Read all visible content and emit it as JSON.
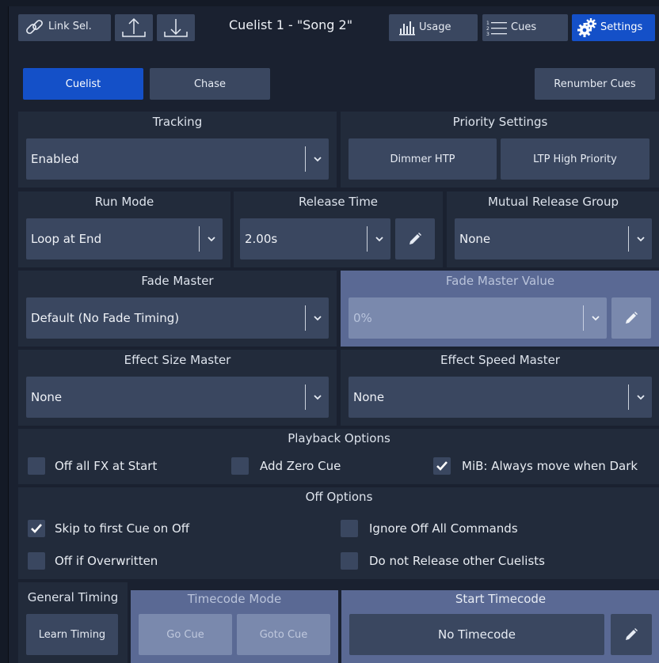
{
  "toolbar": {
    "link_sel": "Link Sel.",
    "title": "Cuelist 1 - \"Song 2\"",
    "usage": "Usage",
    "cues": "Cues",
    "settings": "Settings"
  },
  "mode_tabs": {
    "cuelist": "Cuelist",
    "chase": "Chase",
    "renumber": "Renumber Cues"
  },
  "tracking": {
    "title": "Tracking",
    "value": "Enabled"
  },
  "priority": {
    "title": "Priority Settings",
    "dimmer_htp": "Dimmer HTP",
    "ltp_high": "LTP High Priority"
  },
  "run_mode": {
    "title": "Run Mode",
    "value": "Loop at End"
  },
  "release_time": {
    "title": "Release Time",
    "value": "2.00s"
  },
  "mutual_release": {
    "title": "Mutual Release Group",
    "value": "None"
  },
  "fade_master": {
    "title": "Fade Master",
    "value": "Default (No Fade Timing)"
  },
  "fade_master_value": {
    "title": "Fade Master Value",
    "value": "0%"
  },
  "effect_size": {
    "title": "Effect Size Master",
    "value": "None"
  },
  "effect_speed": {
    "title": "Effect Speed Master",
    "value": "None"
  },
  "playback_options": {
    "title": "Playback Options",
    "items": [
      {
        "label": "Off all FX at Start",
        "checked": false
      },
      {
        "label": "Add Zero Cue",
        "checked": false
      },
      {
        "label": "MiB: Always move when Dark",
        "checked": true
      }
    ]
  },
  "off_options": {
    "title": "Off Options",
    "items": [
      {
        "label": "Skip to first Cue on Off",
        "checked": true
      },
      {
        "label": "Ignore Off All Commands",
        "checked": false
      },
      {
        "label": "Off if Overwritten",
        "checked": false
      },
      {
        "label": "Do not Release other Cuelists",
        "checked": false
      }
    ]
  },
  "general_timing": {
    "title": "General Timing",
    "learn": "Learn Timing"
  },
  "timecode_mode": {
    "title": "Timecode Mode",
    "go_cue": "Go Cue",
    "goto_cue": "Goto Cue"
  },
  "start_timecode": {
    "title": "Start Timecode",
    "value": "No Timecode"
  },
  "colors": {
    "accent": "#1450c8",
    "panel": "#222b3b",
    "button": "#3a4760",
    "highlight": "#5a6994"
  },
  "icons": [
    "link-icon",
    "upload-icon",
    "download-icon",
    "bar-chart-icon",
    "list-icon",
    "gears-icon",
    "chevron-down-icon",
    "pencil-icon",
    "check-icon"
  ]
}
